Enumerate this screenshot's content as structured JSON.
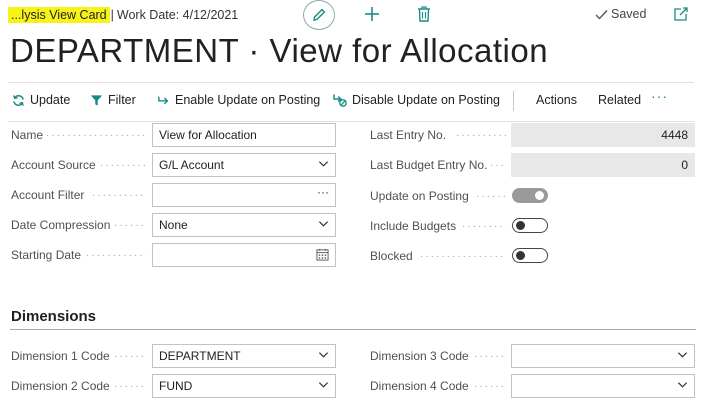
{
  "header": {
    "breadcrumb_highlight": "...lysis View Card",
    "breadcrumb_sep": "|",
    "work_date": "Work Date: 4/12/2021",
    "saved_label": "Saved",
    "title": "DEPARTMENT · View for Allocation"
  },
  "actions": {
    "update": "Update",
    "filter": "Filter",
    "enable_update": "Enable Update on Posting",
    "disable_update": "Disable Update on Posting",
    "actions": "Actions",
    "related": "Related",
    "more": "···"
  },
  "general": {
    "name": {
      "label": "Name",
      "value": "View for Allocation"
    },
    "account_source": {
      "label": "Account Source",
      "value": "G/L Account"
    },
    "account_filter": {
      "label": "Account Filter",
      "value": "",
      "assist": "···"
    },
    "date_compression": {
      "label": "Date Compression",
      "value": "None"
    },
    "starting_date": {
      "label": "Starting Date",
      "value": ""
    },
    "last_entry_no": {
      "label": "Last Entry No.",
      "value": "4448"
    },
    "last_budget_entry_no": {
      "label": "Last Budget Entry No.",
      "value": "0"
    },
    "update_on_posting": {
      "label": "Update on Posting",
      "value": true
    },
    "include_budgets": {
      "label": "Include Budgets",
      "value": false
    },
    "blocked": {
      "label": "Blocked",
      "value": false
    }
  },
  "dimensions": {
    "title": "Dimensions",
    "dim1": {
      "label": "Dimension 1 Code",
      "value": "DEPARTMENT"
    },
    "dim2": {
      "label": "Dimension 2 Code",
      "value": "FUND"
    },
    "dim3": {
      "label": "Dimension 3 Code",
      "value": ""
    },
    "dim4": {
      "label": "Dimension 4 Code",
      "value": ""
    }
  },
  "colors": {
    "accent": "#1a8b84",
    "highlight": "#f7f21a",
    "readonly_bg": "#e8e8e8"
  },
  "icons": {
    "edit": "pencil-icon",
    "new": "plus-icon",
    "delete": "trash-icon",
    "saved": "check-icon",
    "popout": "open-in-new-icon",
    "update": "refresh-icon",
    "filter": "funnel-icon",
    "enable": "arrow-right-icon",
    "disable": "arrow-block-icon",
    "dropdown": "chevron-down-icon",
    "calendar": "calendar-icon"
  }
}
